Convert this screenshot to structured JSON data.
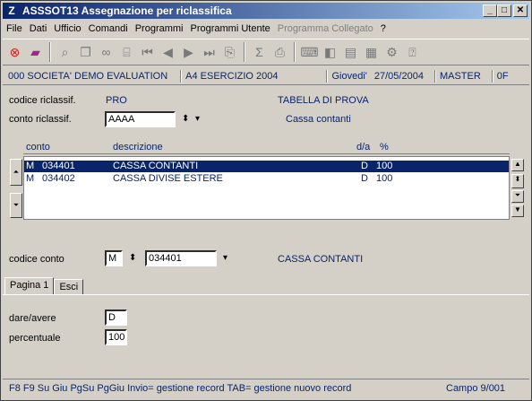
{
  "window": {
    "title_icon": "Z",
    "title": "ASSSOT13  Assegnazione per riclassifica",
    "minimize_label": "_",
    "maximize_label": "□",
    "close_label": "✕"
  },
  "menu": [
    "File",
    "Dati",
    "Ufficio",
    "Comandi",
    "Programmi",
    "Programmi Utente",
    "Programma Collegato",
    "?"
  ],
  "toolbar_icons": [
    "stop-icon",
    "book-icon",
    "search-icon",
    "copy-icon",
    "binoculars-icon",
    "stamp-icon",
    "first-record-icon",
    "prev-record-icon",
    "next-record-icon",
    "last-record-icon",
    "import-icon",
    "sum-icon",
    "print-icon",
    "keyboard-icon",
    "eraser-icon",
    "document-icon",
    "settings-icon",
    "help-icon"
  ],
  "info": {
    "company": "000 SOCIETA' DEMO EVALUATION",
    "year": "A4 ESERCIZIO 2004",
    "day": "Giovedi'",
    "date": "27/05/2004",
    "user": "MASTER",
    "code": "0F"
  },
  "form": {
    "codice_riclassif_label": "codice riclassif.",
    "codice_riclassif_value": "PRO",
    "table_name": "TABELLA DI PROVA",
    "conto_riclassif_label": "conto riclassif.",
    "conto_riclassif_value": "AAAA",
    "conto_riclassif_desc": "Cassa contanti",
    "spin_glyph": "⬍",
    "dropdown_glyph": "▾"
  },
  "grid": {
    "columns": [
      "conto",
      "descrizione",
      "d/a",
      "%"
    ],
    "rows": [
      {
        "tipo": "M",
        "conto": "034401",
        "descrizione": "CASSA CONTANTI",
        "da": "D",
        "perc": "100"
      },
      {
        "tipo": "M",
        "conto": "034402",
        "descrizione": "CASSA DIVISE ESTERE",
        "da": "D",
        "perc": "100"
      }
    ]
  },
  "codice_conto": {
    "label": "codice conto",
    "tipo": "M",
    "conto": "034401",
    "desc": "CASSA CONTANTI"
  },
  "tabs": [
    "Pagina 1",
    "Esci"
  ],
  "panel": {
    "dare_avere_label": "dare/avere",
    "dare_avere_value": "D",
    "percentuale_label": "percentuale",
    "percentuale_value": "100"
  },
  "footer": {
    "hint": "F8 F9 Su Giu PgSu PgGiu  Invio= gestione record  TAB= gestione nuovo record",
    "field": "Campo  9/001"
  }
}
